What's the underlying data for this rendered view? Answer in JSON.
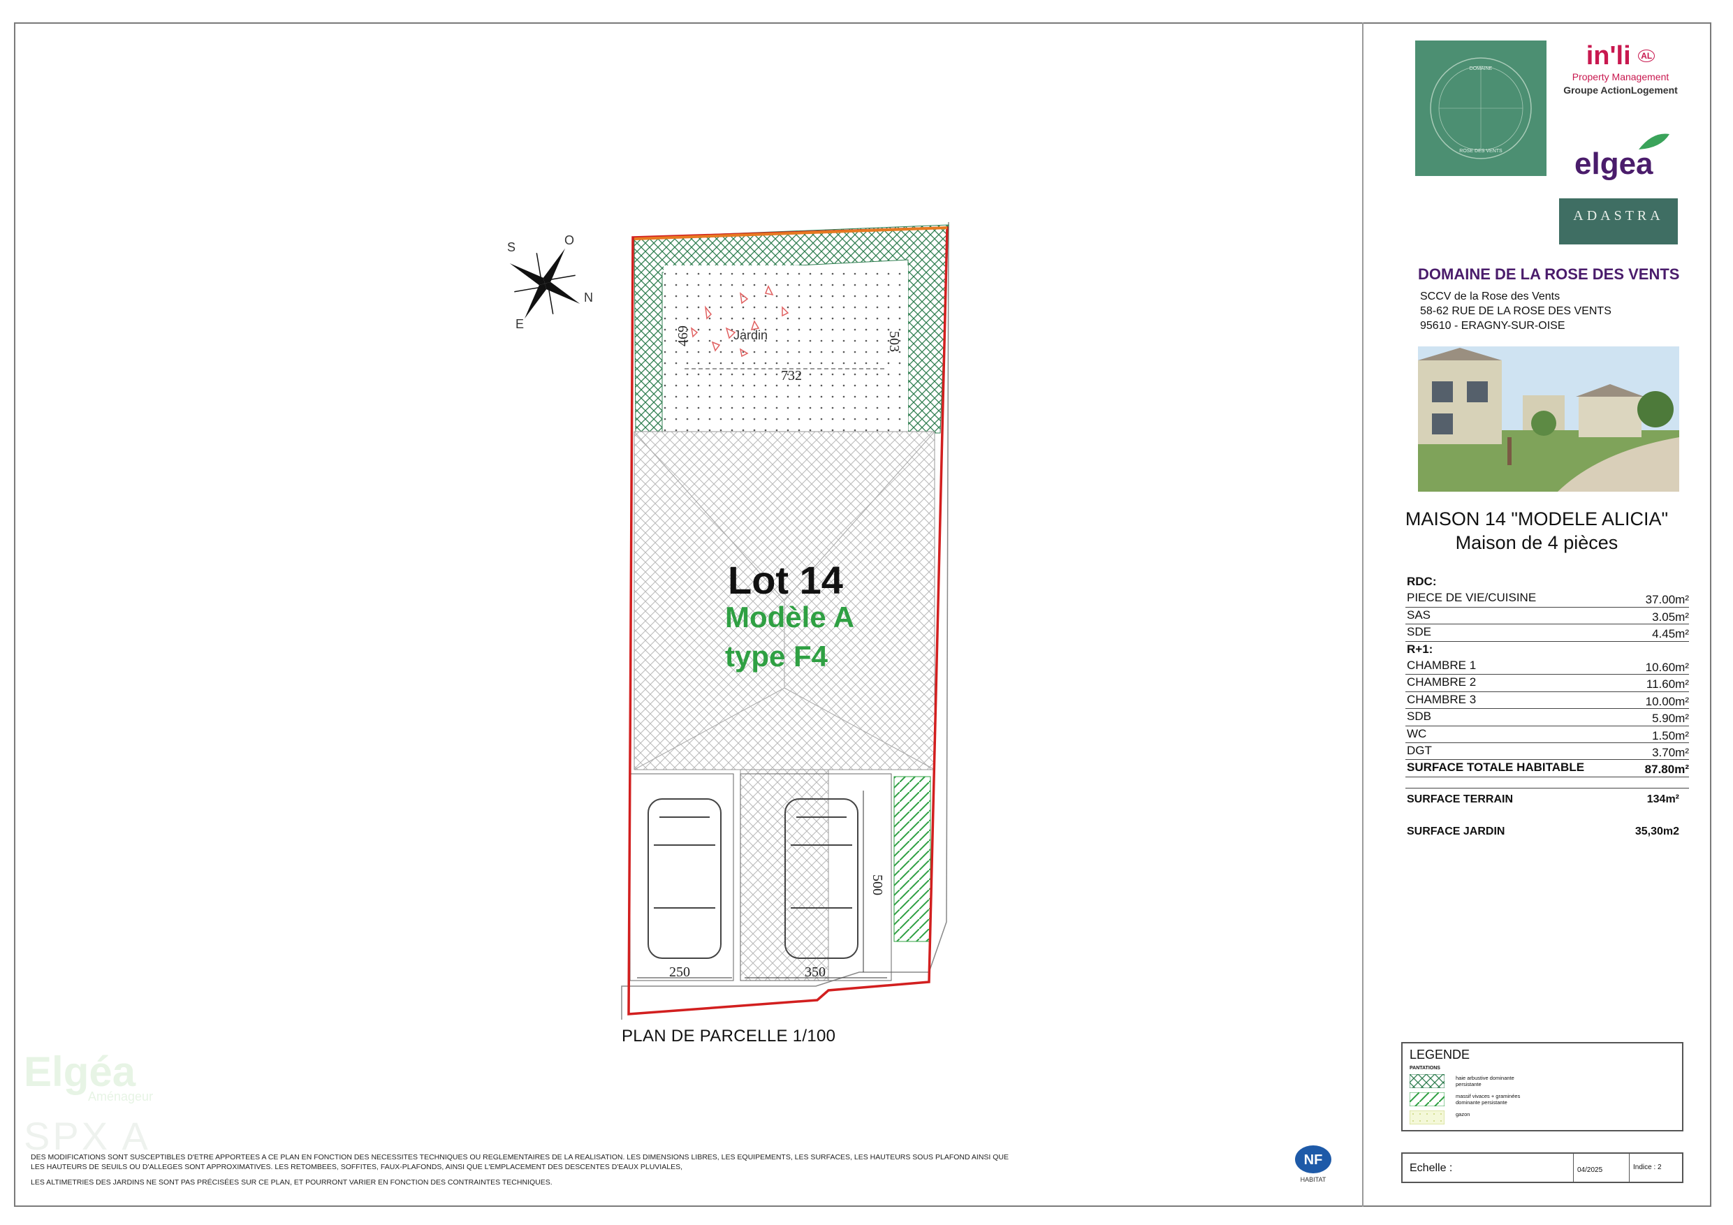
{
  "plan": {
    "title": "PLAN DE PARCELLE 1/100",
    "lot_title": "Lot 14",
    "lot_model_line1": "Modèle A",
    "lot_model_line2": "type F4",
    "garden_label": "Jardin",
    "dimensions": {
      "garden_width": "732",
      "garden_left_height": "469",
      "garden_right_height": "503",
      "parking_left_width": "250",
      "parking_right_width": "350",
      "parking_depth": "500"
    },
    "compass": {
      "north": "N",
      "south": "S",
      "east": "E",
      "west": "O"
    }
  },
  "logos": {
    "domaine_circle_top": "DOMAINE",
    "domaine_circle_bottom": "ROSE DES VENTS",
    "inli_word": "in'li",
    "inli_badge": "AL",
    "inli_pm": "Property Management",
    "inli_group": "Groupe ActionLogement",
    "elgea": "elgea",
    "adastra": "ADASTRA",
    "watermark_elgea": "Elgéa",
    "watermark_sub": "Aménageur",
    "watermark_spx": "SPX  A"
  },
  "project": {
    "title": "DOMAINE DE LA ROSE DES VENTS",
    "address_lines": [
      "SCCV de la Rose des Vents",
      "58-62 RUE DE LA ROSE DES VENTS",
      "95610 - ERAGNY-SUR-OISE"
    ],
    "house_title": "MAISON 14 \"MODELE ALICIA\"",
    "house_subtitle": "Maison de 4 pièces"
  },
  "surfaces": {
    "rows": [
      {
        "label": "RDC:",
        "value": "",
        "kind": "head"
      },
      {
        "label": "PIECE DE VIE/CUISINE",
        "value": "37.00m²",
        "kind": "row"
      },
      {
        "label": "SAS",
        "value": "3.05m²",
        "kind": "row"
      },
      {
        "label": "SDE",
        "value": "4.45m²",
        "kind": "row"
      },
      {
        "label": "R+1:",
        "value": "",
        "kind": "head"
      },
      {
        "label": "CHAMBRE 1",
        "value": "10.60m²",
        "kind": "row"
      },
      {
        "label": "CHAMBRE 2",
        "value": "11.60m²",
        "kind": "row"
      },
      {
        "label": "CHAMBRE 3",
        "value": "10.00m²",
        "kind": "row"
      },
      {
        "label": "SDB",
        "value": "5.90m²",
        "kind": "row"
      },
      {
        "label": "WC",
        "value": "1.50m²",
        "kind": "row"
      },
      {
        "label": "DGT",
        "value": "3.70m²",
        "kind": "row"
      },
      {
        "label": "SURFACE TOTALE HABITABLE",
        "value": "87.80m²",
        "kind": "total"
      }
    ],
    "terrain_label": "SURFACE TERRAIN",
    "terrain_value": "134m²",
    "jardin_label": "SURFACE JARDIN",
    "jardin_value": "35,30m2"
  },
  "legend": {
    "title": "LEGENDE",
    "subtitle": "PANTATIONS",
    "items": [
      {
        "text": "haie arbustive dominante persistante"
      },
      {
        "text": "massif vivaces + graminées dominante persistante"
      },
      {
        "text": "gazon"
      }
    ]
  },
  "footer": {
    "scale_label": "Echelle :",
    "date": "04/2025",
    "index": "Indice : 2"
  },
  "disclaimer": {
    "line1": "DES MODIFICATIONS SONT SUSCEPTIBLES D'ETRE APPORTEES A CE PLAN EN FONCTION DES NECESSITES TECHNIQUES OU REGLEMENTAIRES DE LA REALISATION. LES DIMENSIONS LIBRES, LES EQUIPEMENTS, LES SURFACES, LES HAUTEURS SOUS PLAFOND AINSI QUE LES HAUTEURS DE SEUILS OU D'ALLEGES SONT APPROXIMATIVES. LES RETOMBEES, SOFFITES, FAUX-PLAFONDS, AINSI QUE L'EMPLACEMENT DES DESCENTES D'EAUX PLUVIALES,",
    "line2": "LES ALTIMETRIES DES JARDINS NE SONT PAS PRÉCISÉES SUR CE PLAN, ET POURRONT VARIER EN FONCTION DES CONTRAINTES TECHNIQUES."
  },
  "nf_logo": {
    "mark": "NF",
    "label": "HABITAT"
  },
  "colors": {
    "parcel_red": "#d21f1f",
    "hedge_green": "#2e7d4f",
    "lot_green": "#2fa043",
    "brand_purple": "#4a1c6b",
    "brand_pink": "#c8184f",
    "domaine_green": "#4c8f72",
    "adastra_green": "#3f6e63"
  }
}
